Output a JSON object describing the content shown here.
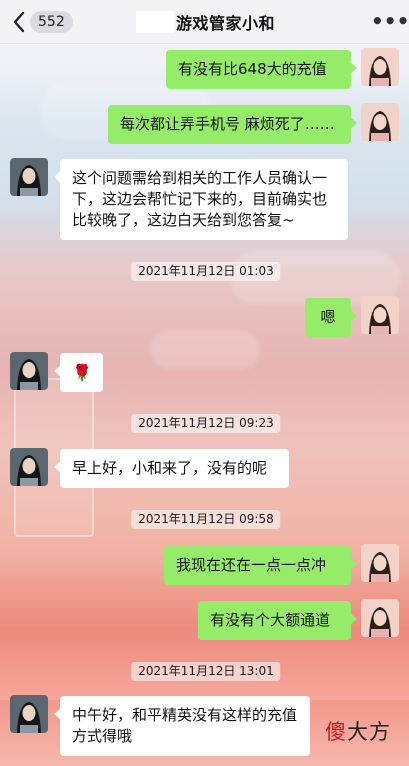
{
  "header": {
    "unread_count": "552",
    "title": "游戏管家小和"
  },
  "messages": [
    {
      "type": "sent",
      "text": "有没有比648大的充值"
    },
    {
      "type": "sent",
      "text": "每次都让弄手机号 麻烦死了……"
    },
    {
      "type": "recv",
      "text": "这个问题需给到相关的工作人员确认一下，这边会帮忙记下来的，目前确实也比较晚了，这边白天给到您答复~"
    },
    {
      "type": "time",
      "text": "2021年11月12日 01:03"
    },
    {
      "type": "sent",
      "text": "嗯"
    },
    {
      "type": "recv",
      "text": "🌹"
    },
    {
      "type": "time",
      "text": "2021年11月12日 09:23"
    },
    {
      "type": "recv",
      "text": "早上好，小和来了，没有的呢"
    },
    {
      "type": "time",
      "text": "2021年11月12日 09:58"
    },
    {
      "type": "sent",
      "text": "我现在还在一点一点冲"
    },
    {
      "type": "sent",
      "text": "有没有个大额通道"
    },
    {
      "type": "time",
      "text": "2021年11月12日 13:01"
    },
    {
      "type": "recv",
      "text": "中午好，和平精英没有这样的充值方式得哦"
    }
  ],
  "watermark": {
    "first_char": "傻",
    "rest": "大方"
  },
  "colors": {
    "sent_bubble": "#95ec69",
    "recv_bubble": "#ffffff",
    "header_bg": "#f3f3f6"
  }
}
